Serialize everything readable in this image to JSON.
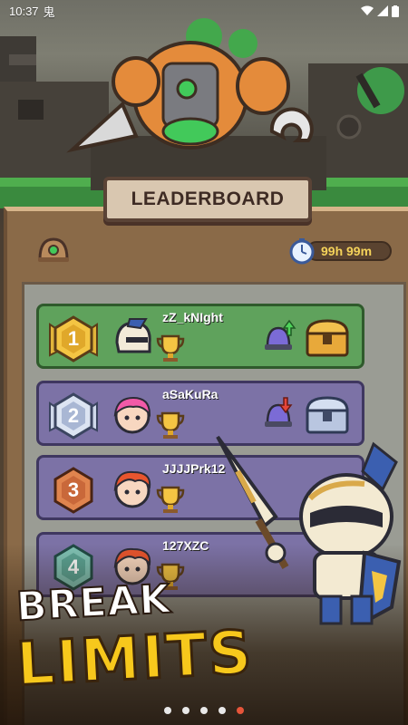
{
  "status_bar": {
    "time": "10:37",
    "app_glyph": "鬼"
  },
  "title": "LEADERBOARD",
  "timer": {
    "value": "99h 99m",
    "icon": "stopwatch-icon"
  },
  "players": [
    {
      "rank": "1",
      "name": "zZ_kNIght",
      "color": "#5fa25c"
    },
    {
      "rank": "2",
      "name": "aSaKuRa",
      "color": "#7c72a6"
    },
    {
      "rank": "3",
      "name": "JJJJPrk12",
      "color": "#7c72a6"
    },
    {
      "rank": "4",
      "name": "127XZC",
      "color": "#7c72a6"
    }
  ],
  "promo": {
    "line1": "BREAK",
    "line2": "LIMITS"
  },
  "pagination": {
    "total": 5,
    "active": 5
  }
}
